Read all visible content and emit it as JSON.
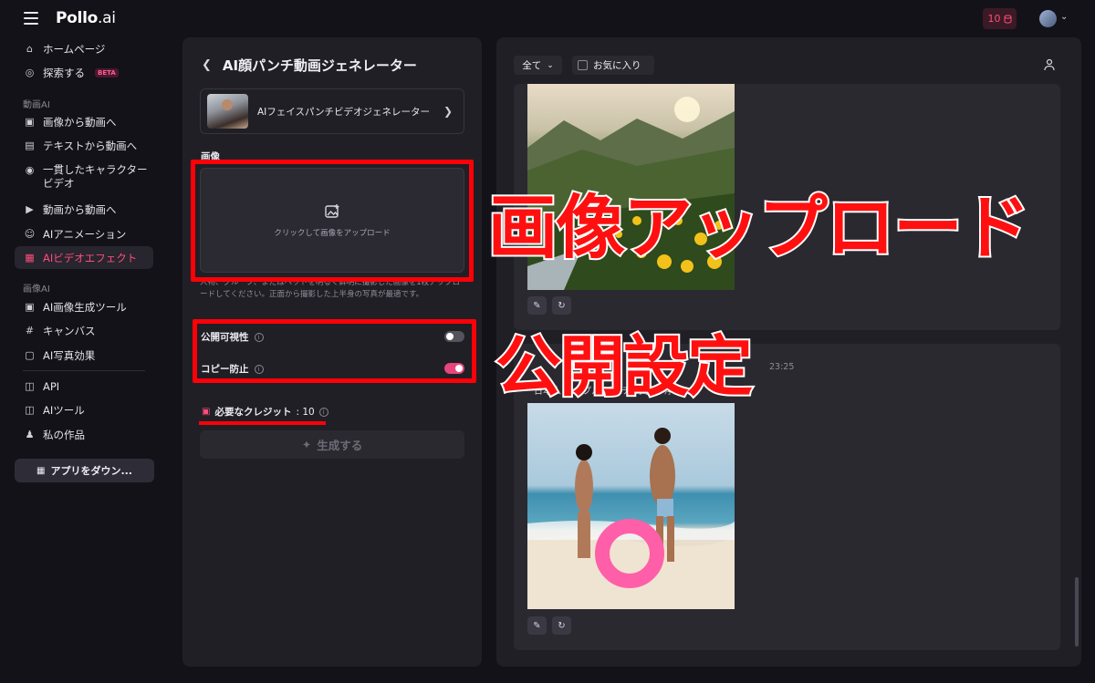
{
  "app": {
    "logo_main": "Pollo",
    "logo_suffix": ".ai",
    "credits": "10"
  },
  "sidebar": {
    "home": "ホームページ",
    "explore": "探索する",
    "beta": "BETA",
    "section_video": "動画AI",
    "image_to_video": "画像から動画へ",
    "text_to_video": "テキストから動画へ",
    "consistent_char": "一貫したキャラクタービデオ",
    "image_to_video_2": "動画から動画へ",
    "ai_animation": "AIアニメーション",
    "ai_video_effect": "AIビデオエフェクト",
    "section_image": "画像AI",
    "ai_image_gen": "AI画像生成ツール",
    "canvas": "キャンバス",
    "ai_photo_effect": "AI写真効果",
    "api": "API",
    "ai_tools": "AIツール",
    "my_works": "私の作品",
    "download_app": "アプリをダウン..."
  },
  "panel": {
    "title": "AI顔パンチ動画ジェネレーター",
    "template_name": "AIフェイスパンチビデオジェネレーター",
    "image_label": "画像",
    "upload_text": "クリックして画像をアップロード",
    "hint": "人物、グループ、またはペットを明るく鮮明に撮影した画像を1枚アップロードしてください。正面から撮影した上半身の写真が最適です。",
    "public_visibility": "公開可視性",
    "copy_protection": "コピー防止",
    "required_credits_label": "必要なクレジット",
    "required_credits_value": ": 10",
    "generate": "生成する"
  },
  "toggles": {
    "public_visibility_on": false,
    "copy_protection_on": true
  },
  "right": {
    "filter_all": "全て",
    "favorites": "お気に入り",
    "card2_time": "23:25",
    "card2_tags": "日本人  カップル  ビーチ  海水浴  浮輪"
  },
  "annotations": {
    "upload_caption": "画像アップロード",
    "settings_caption": "公開設定"
  },
  "colors": {
    "accent": "#ff4d7a",
    "annotation_red": "#ff0008",
    "background": "#131218",
    "panel": "#201f26"
  }
}
